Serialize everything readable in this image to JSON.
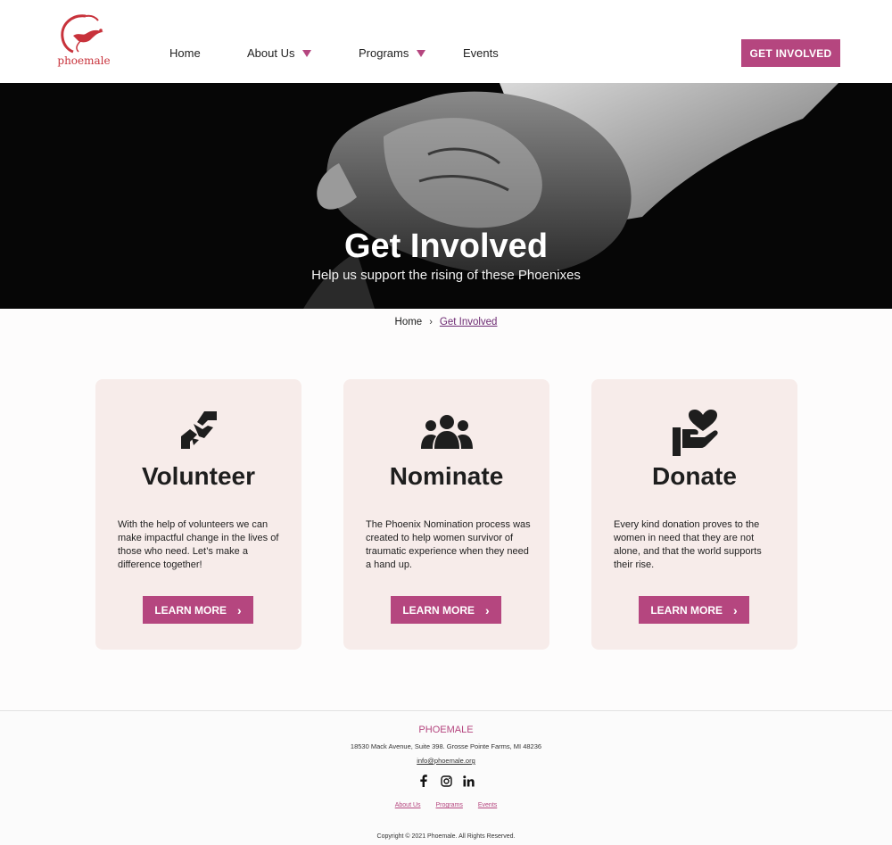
{
  "header": {
    "logo_text": "phoemale",
    "nav": [
      {
        "label": "Home"
      },
      {
        "label": "About Us"
      },
      {
        "label": "Programs"
      },
      {
        "label": "Events"
      }
    ],
    "cta_label": "GET INVOLVED"
  },
  "hero": {
    "title": "Get Involved",
    "subtitle": "Help us support the rising of these Phoenixes"
  },
  "breadcrumb": {
    "home": "Home",
    "separator": "›",
    "current": "Get Involved"
  },
  "cards": [
    {
      "icon": "handshake-icon",
      "title": "Volunteer",
      "text": "With the help of volunteers we can make impactful change in the lives of those who need.  Let’s make a difference together!",
      "button": "LEARN MORE"
    },
    {
      "icon": "people-group-icon",
      "title": "Nominate",
      "text": "The Phoenix Nomination process was created to help women survivor of traumatic experience when they need a hand up.",
      "button": "LEARN MORE"
    },
    {
      "icon": "hand-heart-icon",
      "title": "Donate",
      "text": "Every kind donation proves to the women in need that they are not alone, and that the world supports their rise.",
      "button": "LEARN MORE"
    }
  ],
  "footer": {
    "brand": "PHOEMALE",
    "address": "18530 Mack Avenue, Suite 398. Grosse Pointe Farms, MI 48236",
    "email": "info@phoemale.org",
    "socials": [
      "facebook-icon",
      "instagram-icon",
      "linkedin-icon"
    ],
    "links": [
      "About Us",
      "Programs",
      "Events"
    ],
    "copyright": "Copyright © 2021 Phoemale. All Rights Reserved."
  },
  "colors": {
    "accent": "#b5467f",
    "card_bg": "#f7ecea",
    "logo_red": "#c8323b",
    "breadcrumb_current": "#6d2a72"
  }
}
